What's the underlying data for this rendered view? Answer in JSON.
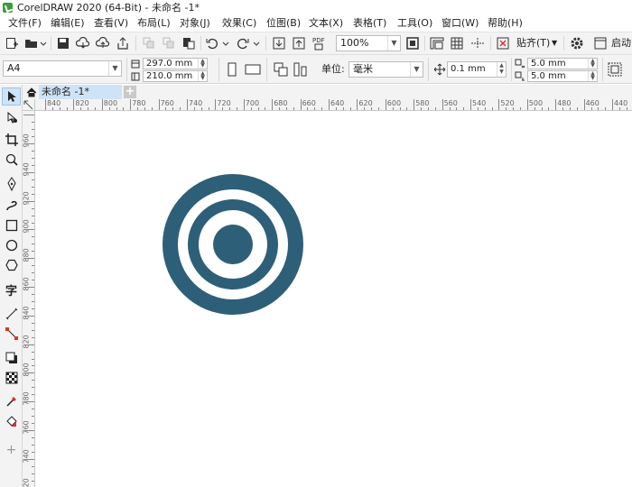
{
  "window": {
    "title": "CorelDRAW 2020 (64-Bit) - 未命名 -1*"
  },
  "menu": {
    "items": [
      "文件(F)",
      "编辑(E)",
      "查看(V)",
      "布局(L)",
      "对象(J)",
      "效果(C)",
      "位图(B)",
      "文本(X)",
      "表格(T)",
      "工具(O)",
      "窗口(W)",
      "帮助(H)"
    ]
  },
  "standard_toolbar": {
    "zoom": "100%",
    "snap_label": "贴齐(T)",
    "launch_label": "启动",
    "pdf_label": "PDF"
  },
  "property_bar": {
    "page_size": "A4",
    "width": "297.0 mm",
    "height": "210.0 mm",
    "unit_label": "单位:",
    "unit_value": "毫米",
    "nudge": "0.1 mm",
    "dup_x": "5.0 mm",
    "dup_y": "5.0 mm"
  },
  "document_tabs": {
    "active_tab": "未命名 -1*",
    "add_tab": "+"
  },
  "rulers": {
    "horizontal_labels": [
      "840",
      "820",
      "800",
      "780",
      "760",
      "740",
      "720",
      "700",
      "680",
      "660",
      "640",
      "620",
      "600",
      "580",
      "560",
      "540",
      "520",
      "500",
      "480",
      "460",
      "440"
    ],
    "vertical_labels": [
      "960",
      "940",
      "920",
      "900",
      "880",
      "860",
      "840",
      "820",
      "800",
      "780",
      "760",
      "740",
      "720"
    ]
  },
  "canvas": {
    "shape": "target-rings",
    "shape_color": "#2e5f78"
  },
  "colors": {
    "accent": "#cfe3f7",
    "shape": "#2e5f78",
    "toolbar_bg": "#f3f3f3"
  }
}
